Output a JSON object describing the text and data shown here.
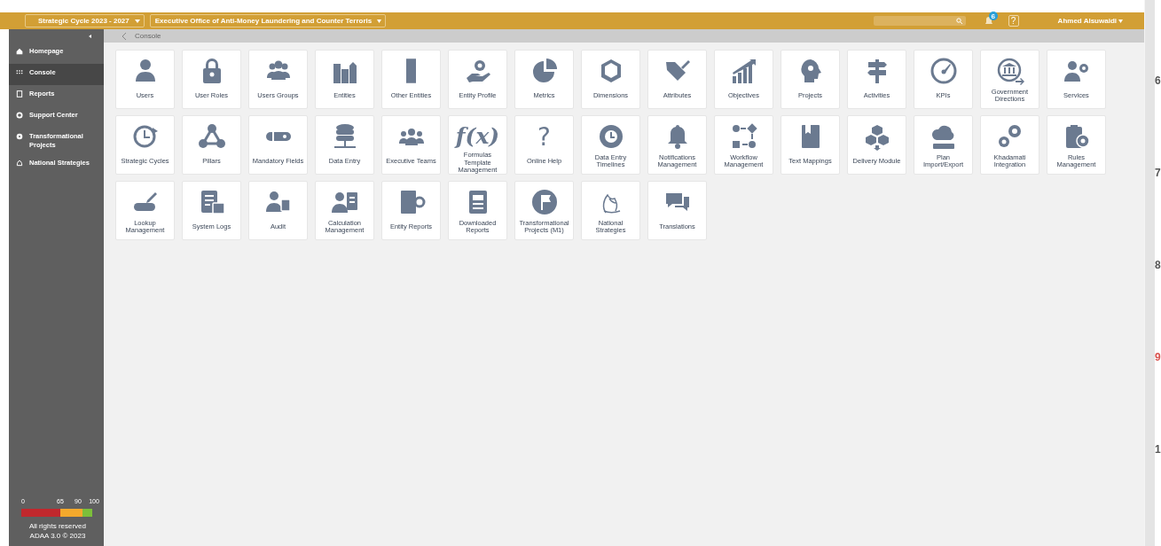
{
  "header": {
    "cycle_dropdown": "Strategic Cycle 2023 - 2027",
    "entity_dropdown": "Executive Office of Anti-Money Laundering and Counter Terroris",
    "notification_count": "6",
    "help": "?",
    "user": "Ahmed Alsuwaidi"
  },
  "sidebar": {
    "items": [
      {
        "label": "Homepage",
        "selected": false
      },
      {
        "label": "Console",
        "selected": true
      },
      {
        "label": "Reports",
        "selected": false
      },
      {
        "label": "Support Center",
        "selected": false
      },
      {
        "label": "Transformational Projects",
        "selected": false
      },
      {
        "label": "National Strategies",
        "selected": false
      }
    ],
    "scale": {
      "ticks": [
        "0",
        "65",
        "90",
        "100"
      ],
      "segments": [
        {
          "color": "#c0282d"
        },
        {
          "color": "#f4a92c"
        },
        {
          "color": "#7cbf3a"
        }
      ]
    },
    "footer": [
      "All rights reserved",
      "ADAA 3.0 © 2023"
    ]
  },
  "breadcrumb": "Console",
  "tiles": [
    {
      "label": "Users"
    },
    {
      "label": "User Roles"
    },
    {
      "label": "Users Groups"
    },
    {
      "label": "Entities"
    },
    {
      "label": "Other Entities"
    },
    {
      "label": "Entity Profile"
    },
    {
      "label": "Metrics"
    },
    {
      "label": "Dimensions"
    },
    {
      "label": "Attributes"
    },
    {
      "label": "Objectives"
    },
    {
      "label": "Projects"
    },
    {
      "label": "Activities"
    },
    {
      "label": "KPIs"
    },
    {
      "label": "Government Directions"
    },
    {
      "label": "Services"
    },
    {
      "label": "Strategic Cycles"
    },
    {
      "label": "Pillars"
    },
    {
      "label": "Mandatory Fields"
    },
    {
      "label": "Data Entry"
    },
    {
      "label": "Executive Teams"
    },
    {
      "label": "Formulas Template Management",
      "glyph": "f(x)"
    },
    {
      "label": "Online Help",
      "glyph": "?"
    },
    {
      "label": "Data Entry Timelines"
    },
    {
      "label": "Notifications Management"
    },
    {
      "label": "Workflow Management"
    },
    {
      "label": "Text Mappings"
    },
    {
      "label": "Delivery Module"
    },
    {
      "label": "Plan Import/Export"
    },
    {
      "label": "Khadamati Integration"
    },
    {
      "label": "Rules Management"
    },
    {
      "label": "Lookup Management"
    },
    {
      "label": "System Logs"
    },
    {
      "label": "Audit"
    },
    {
      "label": "Calculation Management"
    },
    {
      "label": "Entity Reports"
    },
    {
      "label": "Downloaded Reports"
    },
    {
      "label": "Transformational Projects (M1)"
    },
    {
      "label": "National Strategies"
    },
    {
      "label": "Translations"
    }
  ],
  "right_edge": [
    {
      "text": "6",
      "color": "#555555"
    },
    {
      "text": "7",
      "color": "#555555"
    },
    {
      "text": "8",
      "color": "#555555"
    },
    {
      "text": "9",
      "color": "#d9534f"
    },
    {
      "text": "1",
      "color": "#555555"
    }
  ]
}
